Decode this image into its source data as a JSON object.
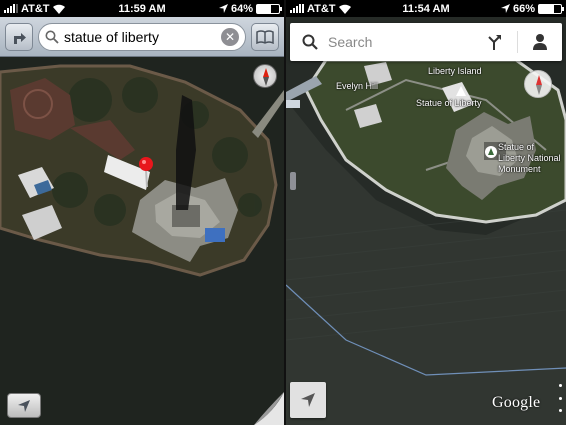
{
  "left_phone": {
    "status": {
      "carrier": "AT&T",
      "time": "11:59 AM",
      "battery": "64%",
      "battery_level": 0.64
    },
    "search": {
      "value": "statue of liberty"
    }
  },
  "right_phone": {
    "status": {
      "carrier": "AT&T",
      "time": "11:54 AM",
      "battery": "66%",
      "battery_level": 0.66
    },
    "search": {
      "placeholder": "Search"
    },
    "map_labels": {
      "liberty_island": "Liberty Island",
      "evelyn_hill": "Evelyn Hill",
      "statue_of_liberty": "Statue of Liberty",
      "monument_line1": "Statue of",
      "monument_line2": "Liberty National",
      "monument_line3": "Monument"
    },
    "attribution": "Google"
  },
  "colors": {
    "water_dark": "#242a24",
    "grass": "#3d4a2c",
    "ios_bar": "#b9c3cd",
    "pin_red": "#e8161c"
  },
  "icons": {
    "directions": "directions-arrow-icon",
    "bookmarks": "open-book-icon",
    "search": "magnifier-icon",
    "clear": "clear-x-icon",
    "compass": "compass-icon",
    "location": "location-arrow-icon",
    "profile": "person-icon",
    "route": "route-fork-icon"
  }
}
